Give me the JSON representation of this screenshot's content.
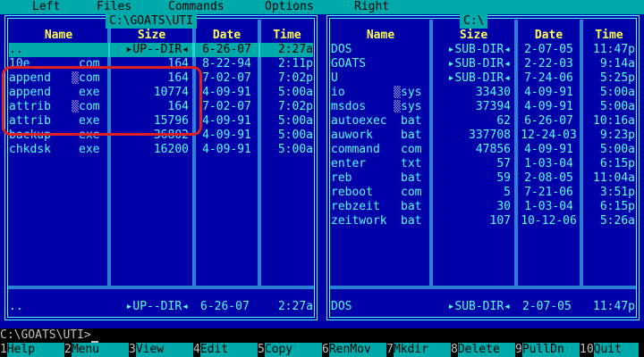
{
  "menu": [
    "Left",
    "Files",
    "Commands",
    "Options",
    "Right"
  ],
  "left_panel": {
    "title": "C:\\GOATS\\UTI",
    "headers": [
      "Name",
      "Size",
      "Date",
      "Time"
    ],
    "rows": [
      {
        "name": "..",
        "ext": "",
        "size": "▸UP--DIR◂",
        "date": "6-26-07",
        "time": "2:27a",
        "selected": true
      },
      {
        "name": "10e",
        "ext": "com",
        "size": "164",
        "date": "8-22-94",
        "time": "2:11p"
      },
      {
        "name": "append",
        "ext": "com",
        "size": "164",
        "date": "7-02-07",
        "time": "7:02p",
        "tick": true
      },
      {
        "name": "append",
        "ext": "exe",
        "size": "10774",
        "date": "4-09-91",
        "time": "5:00a"
      },
      {
        "name": "attrib",
        "ext": "com",
        "size": "164",
        "date": "7-02-07",
        "time": "7:02p",
        "tick": true
      },
      {
        "name": "attrib",
        "ext": "exe",
        "size": "15796",
        "date": "4-09-91",
        "time": "5:00a"
      },
      {
        "name": "backup",
        "ext": "exe",
        "size": "36802",
        "date": "4-09-91",
        "time": "5:00a"
      },
      {
        "name": "chkdsk",
        "ext": "exe",
        "size": "16200",
        "date": "4-09-91",
        "time": "5:00a"
      }
    ],
    "status": {
      "name": "..",
      "size": "▸UP--DIR◂",
      "date": "6-26-07",
      "time": "2:27a"
    }
  },
  "right_panel": {
    "title": "C:\\",
    "headers": [
      "Name",
      "Size",
      "Date",
      "Time"
    ],
    "rows": [
      {
        "name": "DOS",
        "ext": "",
        "size": "▸SUB-DIR◂",
        "date": "2-07-05",
        "time": "11:47p"
      },
      {
        "name": "GOATS",
        "ext": "",
        "size": "▸SUB-DIR◂",
        "date": "2-22-03",
        "time": "9:14a"
      },
      {
        "name": "U",
        "ext": "",
        "size": "▸SUB-DIR◂",
        "date": "7-24-06",
        "time": "5:25p"
      },
      {
        "name": "io",
        "ext": "sys",
        "size": "33430",
        "date": "4-09-91",
        "time": "5:00a",
        "tick": true
      },
      {
        "name": "msdos",
        "ext": "sys",
        "size": "37394",
        "date": "4-09-91",
        "time": "5:00a",
        "tick": true
      },
      {
        "name": "autoexec",
        "ext": "bat",
        "size": "62",
        "date": "6-26-07",
        "time": "10:16a"
      },
      {
        "name": "auwork",
        "ext": "bat",
        "size": "337708",
        "date": "12-24-03",
        "time": "9:23p"
      },
      {
        "name": "command",
        "ext": "com",
        "size": "47856",
        "date": "4-09-91",
        "time": "5:00a"
      },
      {
        "name": "enter",
        "ext": "txt",
        "size": "57",
        "date": "1-03-04",
        "time": "6:15p"
      },
      {
        "name": "reb",
        "ext": "bat",
        "size": "59",
        "date": "2-08-05",
        "time": "11:04a"
      },
      {
        "name": "reboot",
        "ext": "com",
        "size": "5",
        "date": "7-21-06",
        "time": "3:51p"
      },
      {
        "name": "rebzeit",
        "ext": "bat",
        "size": "30",
        "date": "1-03-04",
        "time": "6:15p"
      },
      {
        "name": "zeitwork",
        "ext": "bat",
        "size": "107",
        "date": "10-12-06",
        "time": "5:26a"
      }
    ],
    "status": {
      "name": "DOS",
      "size": "▸SUB-DIR◂",
      "date": "2-07-05",
      "time": "11:47p"
    }
  },
  "command_line": "C:\\GOATS\\UTI>",
  "fkeys": [
    {
      "num": "1",
      "label": "Help"
    },
    {
      "num": "2",
      "label": "Menu"
    },
    {
      "num": "3",
      "label": "View"
    },
    {
      "num": "4",
      "label": "Edit"
    },
    {
      "num": "5",
      "label": "Copy"
    },
    {
      "num": "6",
      "label": "RenMov"
    },
    {
      "num": "7",
      "label": "Mkdir"
    },
    {
      "num": "8",
      "label": "Delete"
    },
    {
      "num": "9",
      "label": "PullDn"
    },
    {
      "num": "10",
      "label": "Quit"
    }
  ],
  "colors": {
    "background": "#0000a8",
    "text": "#55ffff",
    "header": "#ffff55",
    "bar": "#00aaaa",
    "annotation": "#e02020"
  }
}
